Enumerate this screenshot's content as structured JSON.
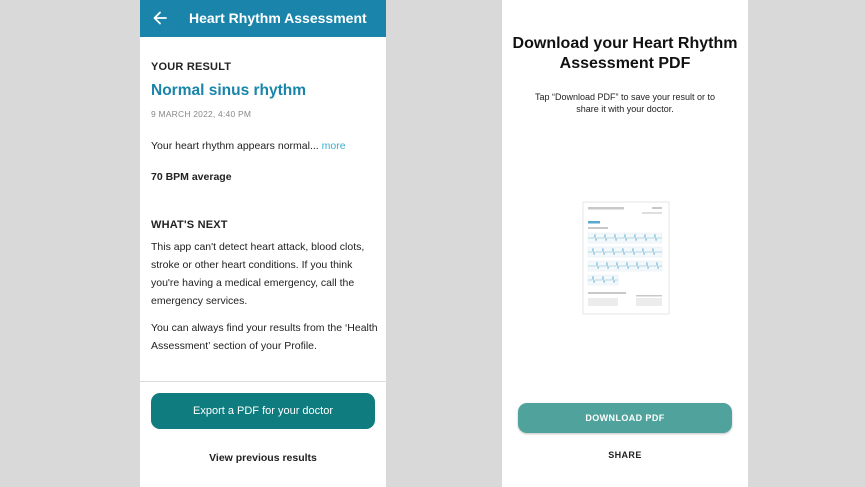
{
  "left": {
    "header_title": "Heart Rhythm Assessment",
    "your_result_label": "YOUR RESULT",
    "result_title": "Normal sinus rhythm",
    "date": "9 MARCH 2022, 4:40 PM",
    "summary": "Your heart rhythm appears normal...",
    "more_link": "more",
    "bpm": "70 BPM average",
    "whats_next_label": "WHAT'S NEXT",
    "whats_next_text": "This app can't detect heart attack, blood clots, stroke or other heart conditions. If you think you're having a medical emergency, call the emergency services.",
    "profile_text": "You can always find your results from the ‘Health Assessment’ section of your Profile.",
    "export_button": "Export a PDF for your doctor",
    "view_previous": "View previous results"
  },
  "right": {
    "title": "Download your Heart Rhythm Assessment PDF",
    "description": "Tap “Download PDF” to save your result or to share it with your doctor.",
    "download_button": "DOWNLOAD PDF",
    "share_button": "SHARE"
  },
  "colors": {
    "header": "#1a84ab",
    "accent_text": "#1a84ab",
    "link": "#3ab0d0",
    "export_button": "#0f7c80",
    "download_button": "#4fa39c",
    "background": "#d9d9d9"
  },
  "icons": {
    "back": "arrow-left-icon",
    "pdf_preview": "pdf-document-preview"
  }
}
